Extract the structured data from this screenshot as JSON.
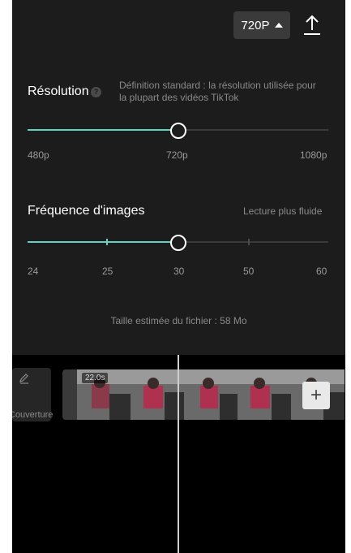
{
  "toolbar": {
    "resolution_button_label": "720P",
    "caret_icon": "caret-up-icon",
    "export_icon": "export-upload-icon"
  },
  "resolution": {
    "title": "Résolution",
    "help_icon": "help-icon",
    "help_text": "?",
    "description": "Définition standard : la résolution utilisée pour la plupart des vidéos TikTok",
    "options": [
      "480p",
      "720p",
      "1080p"
    ],
    "selected": "720p",
    "selected_fraction": 0.5
  },
  "frame_rate": {
    "title": "Fréquence d'images",
    "hint": "Lecture plus fluide",
    "options": [
      "24",
      "25",
      "30",
      "50",
      "60"
    ],
    "selected": "30",
    "selected_fraction": 0.5
  },
  "file_size": "Taille estimée du fichier : 58 Mo",
  "timeline": {
    "cover_label": "Couverture",
    "cover_icon": "edit-pencil-icon",
    "clip_duration": "22.0s",
    "add_label": "+",
    "add_icon": "plus-icon"
  },
  "colors": {
    "panel": "#1c1c1c",
    "accent": "#5fd3c0",
    "track": "#3a3a3a"
  }
}
